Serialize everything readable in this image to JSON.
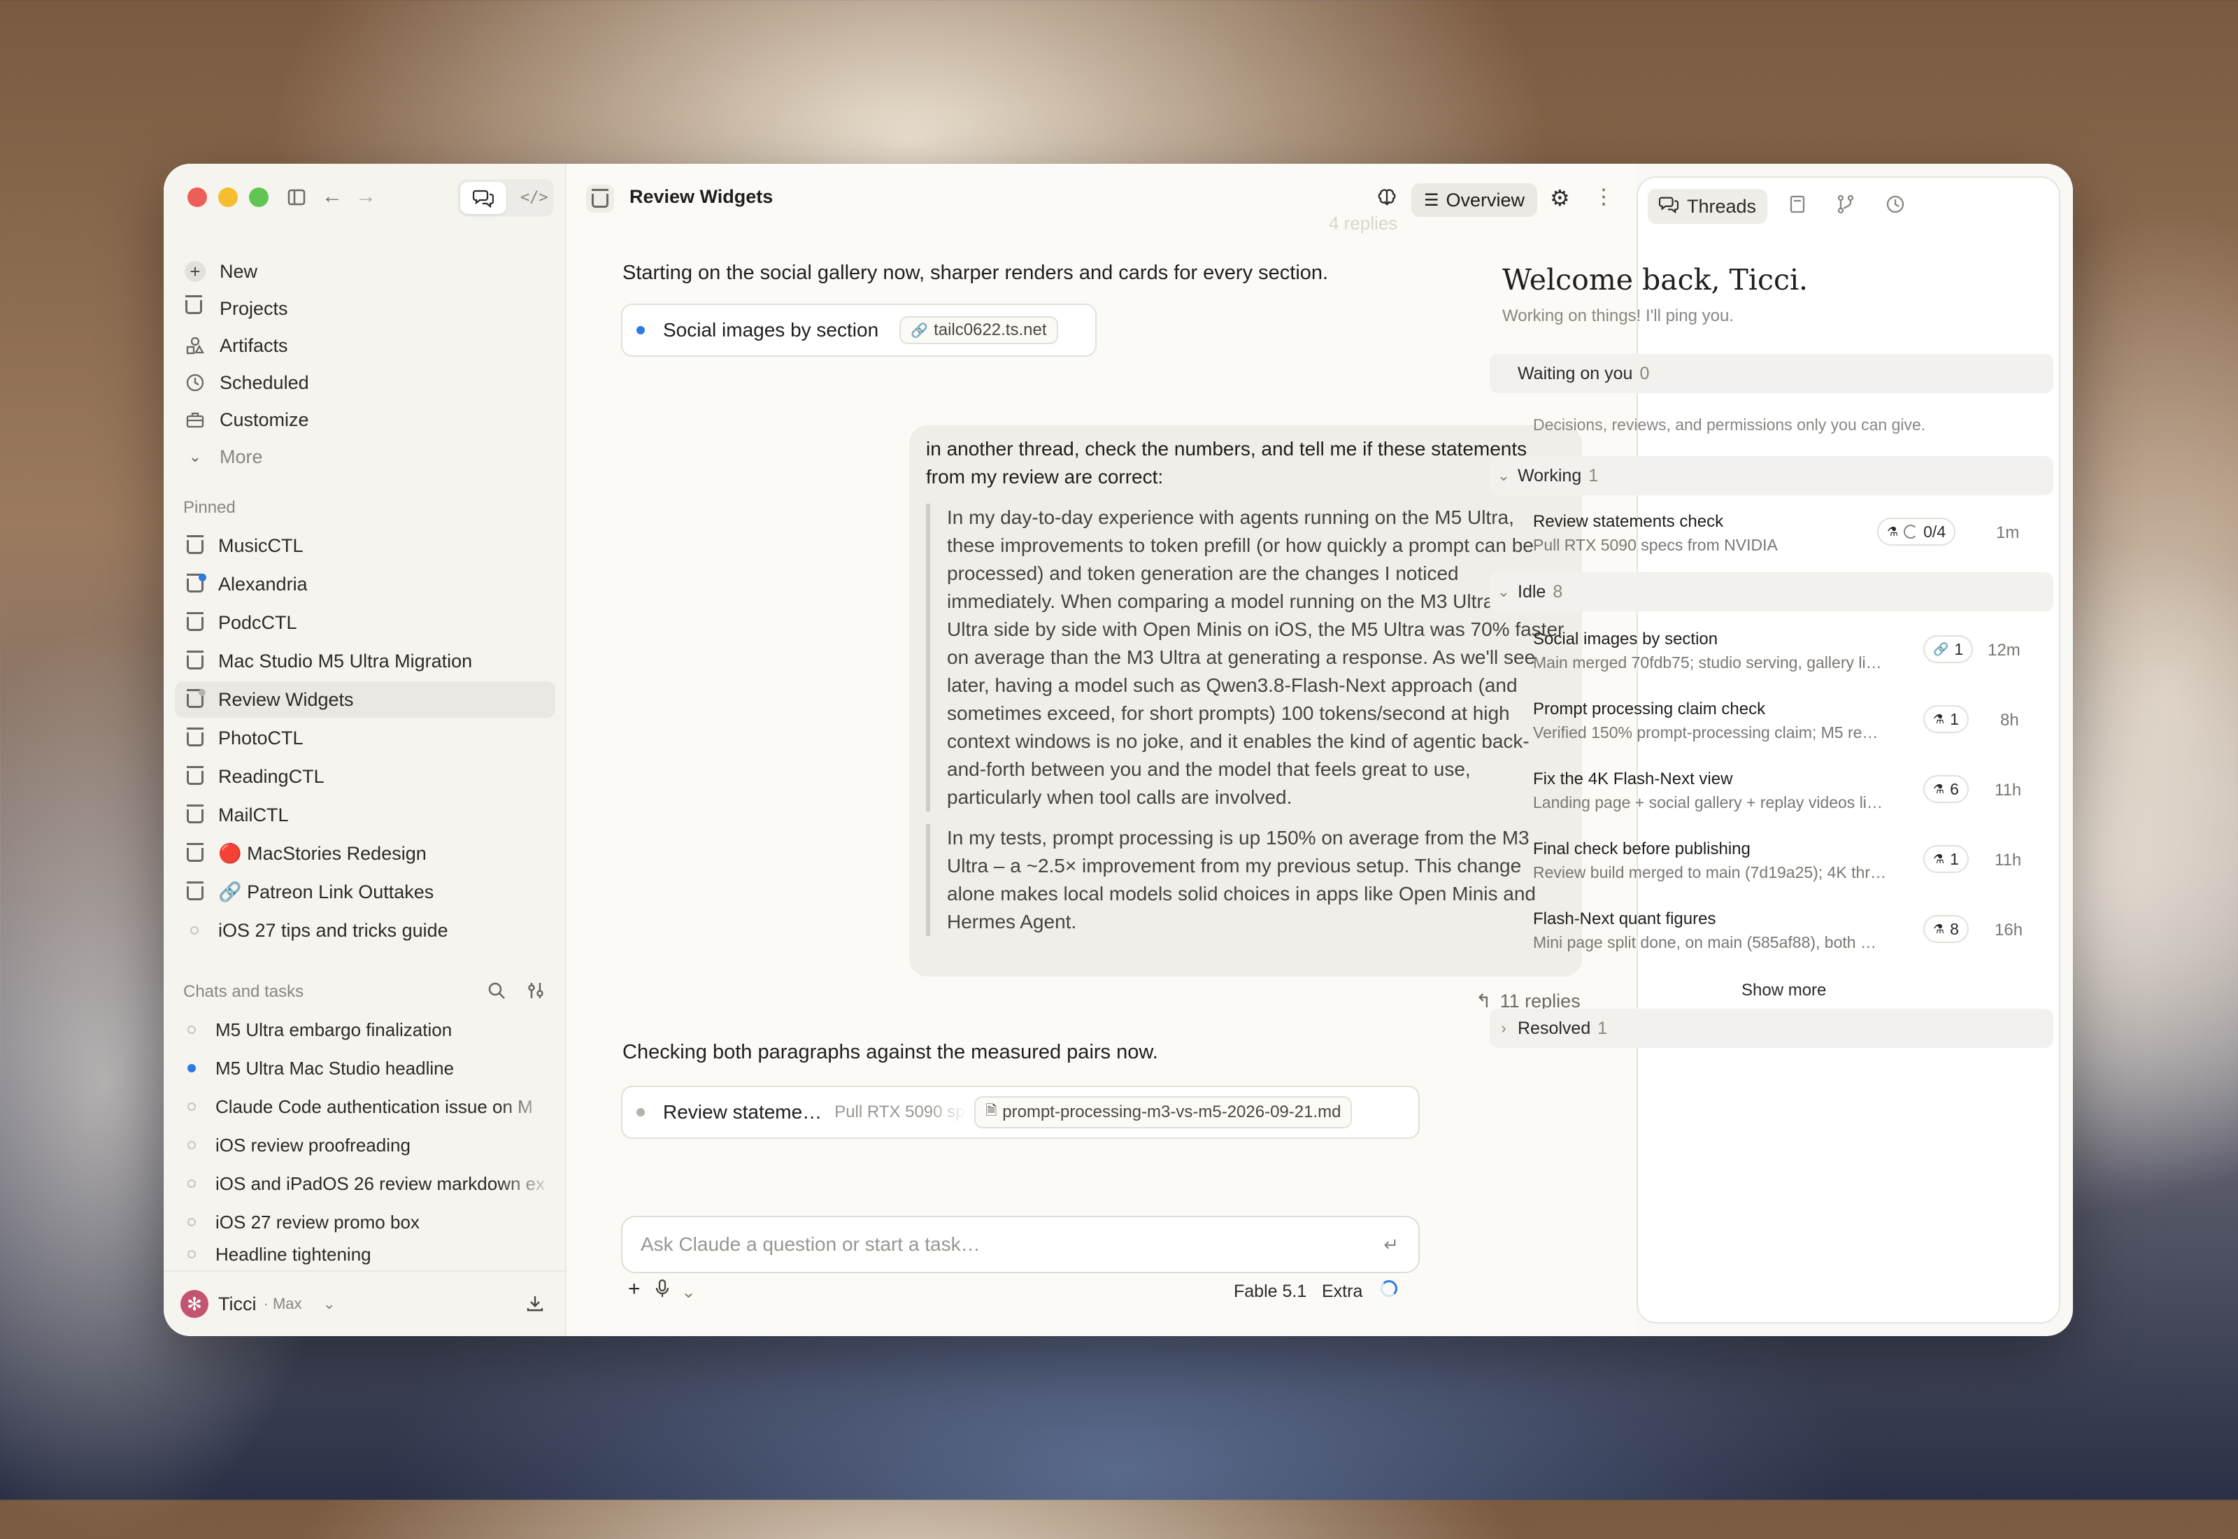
{
  "colors": {
    "accent_blue": "#2c7be5",
    "avatar": "#c4556f",
    "traffic_red": "#ec5f57",
    "traffic_yellow": "#f4be2f",
    "traffic_green": "#61c554"
  },
  "sidebar": {
    "nav": [
      {
        "label": "New",
        "icon": "plus-icon"
      },
      {
        "label": "Projects",
        "icon": "tray-icon"
      },
      {
        "label": "Artifacts",
        "icon": "artifacts-icon"
      },
      {
        "label": "Scheduled",
        "icon": "clock-icon"
      },
      {
        "label": "Customize",
        "icon": "briefcase-icon"
      },
      {
        "label": "More",
        "icon": "chevron-down-icon"
      }
    ],
    "pinned_label": "Pinned",
    "pinned": [
      "MusicCTL",
      "Alexandria",
      "PodcCTL",
      "Mac Studio M5 Ultra Migration",
      "Review Widgets",
      "PhotoCTL",
      "ReadingCTL",
      "MailCTL",
      "🔴 MacStories Redesign",
      "🔗 Patreon Link Outtakes",
      "iOS 27 tips and tricks guide"
    ],
    "chats_label": "Chats and tasks",
    "chats": [
      "M5 Ultra embargo finalization",
      "M5 Ultra Mac Studio headline",
      "Claude Code authentication issue on M",
      "iOS review proofreading",
      "iOS and iPadOS 26 review markdown ex",
      "iOS 27 review promo box",
      "Headline tightening"
    ],
    "user": {
      "name": "Ticci",
      "plan": "· Max"
    }
  },
  "main": {
    "title": "Review Widgets",
    "overview_label": "Overview",
    "faded_replies": "4 replies",
    "msg1": "Starting on the social gallery now, sharper renders and cards for every section.",
    "chip1": {
      "title": "Social images by section",
      "link": "tailc0622.ts.net"
    },
    "user_intro": "in another thread, check the numbers, and tell me if these statements from my review are correct:",
    "quote1": "In my day-to-day experience with agents running on the M5 Ultra, these improvements to token prefill (or how quickly a prompt can be processed) and token generation are the changes I noticed immediately. When comparing a model running on the M3 Ultra and M5 Ultra side by side with Open Minis on iOS, the M5 Ultra was 70% faster on average than the M3 Ultra at generating a response. As we'll see later, having a model such as Qwen3.8-Flash-Next approach (and sometimes exceed, for short prompts) 100 tokens/second at high context windows is no joke, and it enables the kind of agentic back-and-forth between you and the model that feels great to use, particularly when tool calls are involved.",
    "quote2": "In my tests, prompt processing is up 150% on average from the M3 Ultra – a ~2.5× improvement from my previous setup. This change alone makes local models solid choices in apps like Open Minis and Hermes Agent.",
    "replies": "11 replies",
    "msg2": "Checking both paragraphs against the measured pairs now.",
    "chip2": {
      "title": "Review stateme…",
      "sub": "Pull RTX 5090 specs",
      "file": "prompt-processing-m3-vs-m5-2026-09-21.md"
    },
    "composer_placeholder": "Ask Claude a question or start a task…",
    "model": "Fable 5.1",
    "effort": "Extra"
  },
  "threads": {
    "tab_label": "Threads",
    "welcome": "Welcome back, Ticci.",
    "subtitle": "Working on things! I'll ping you.",
    "waiting": {
      "label": "Waiting on you",
      "count": "0",
      "desc": "Decisions, reviews, and permissions only you can give."
    },
    "working": {
      "label": "Working",
      "count": "1"
    },
    "working_items": [
      {
        "title": "Review statements check",
        "sub": "Pull RTX 5090 specs from NVIDIA",
        "badge": "0/4",
        "age": "1m"
      }
    ],
    "idle": {
      "label": "Idle",
      "count": "8"
    },
    "idle_items": [
      {
        "title": "Social images by section",
        "sub": "Main merged 70fdb75; studio serving, gallery li…",
        "badge": "1",
        "age": "12m",
        "icon": "link-icon"
      },
      {
        "title": "Prompt processing claim check",
        "sub": "Verified 150% prompt-processing claim; M5 re…",
        "badge": "1",
        "age": "8h",
        "icon": "agent-icon"
      },
      {
        "title": "Fix the 4K Flash-Next view",
        "sub": "Landing page + social gallery + replay videos li…",
        "badge": "6",
        "age": "11h",
        "icon": "agent-icon"
      },
      {
        "title": "Final check before publishing",
        "sub": "Review build merged to main (7d19a25); 4K thr…",
        "badge": "1",
        "age": "11h",
        "icon": "agent-icon"
      },
      {
        "title": "Flash-Next quant figures",
        "sub": "Mini page split done, on main (585af88), both …",
        "badge": "8",
        "age": "16h",
        "icon": "agent-icon"
      }
    ],
    "show_more": "Show more",
    "resolved": {
      "label": "Resolved",
      "count": "1"
    }
  }
}
